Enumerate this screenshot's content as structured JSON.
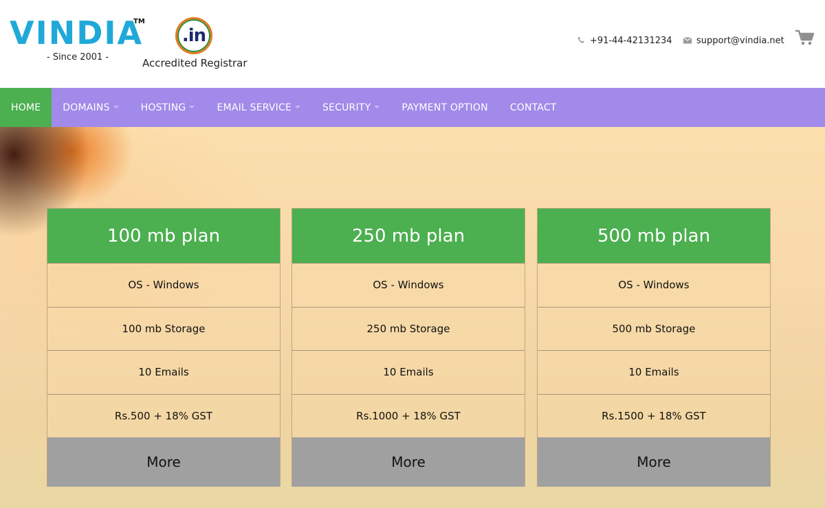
{
  "header": {
    "logo_text": "VINDIA",
    "logo_tm": "TM",
    "since": "- Since 2001 -",
    "in_badge": ".in",
    "accredited": "Accredited Registrar",
    "phone": "+91-44-42131234",
    "email": "support@vindia.net",
    "icons": {
      "phone": "phone-icon",
      "email": "envelope-icon",
      "cart": "cart-icon"
    }
  },
  "nav": {
    "items": [
      {
        "label": "HOME",
        "active": true,
        "dropdown": false
      },
      {
        "label": "DOMAINS",
        "active": false,
        "dropdown": true
      },
      {
        "label": "HOSTING",
        "active": false,
        "dropdown": true
      },
      {
        "label": "EMAIL SERVICE",
        "active": false,
        "dropdown": true
      },
      {
        "label": "SECURITY",
        "active": false,
        "dropdown": true
      },
      {
        "label": "PAYMENT OPTION",
        "active": false,
        "dropdown": false
      },
      {
        "label": "CONTACT",
        "active": false,
        "dropdown": false
      }
    ]
  },
  "plans": [
    {
      "title": "100 mb plan",
      "os": "OS - Windows",
      "storage": "100 mb Storage",
      "emails": "10 Emails",
      "price": "Rs.500 + 18% GST",
      "more": "More"
    },
    {
      "title": "250 mb plan",
      "os": "OS - Windows",
      "storage": "250 mb Storage",
      "emails": "10 Emails",
      "price": "Rs.1000 + 18% GST",
      "more": "More"
    },
    {
      "title": "500 mb plan",
      "os": "OS - Windows",
      "storage": "500 mb Storage",
      "emails": "10 Emails",
      "price": "Rs.1500 + 18% GST",
      "more": "More"
    }
  ],
  "colors": {
    "nav_bg": "#a18ae9",
    "accent_green": "#4caf50",
    "logo_blue": "#20a9d8",
    "more_button": "#a0a0a0"
  }
}
